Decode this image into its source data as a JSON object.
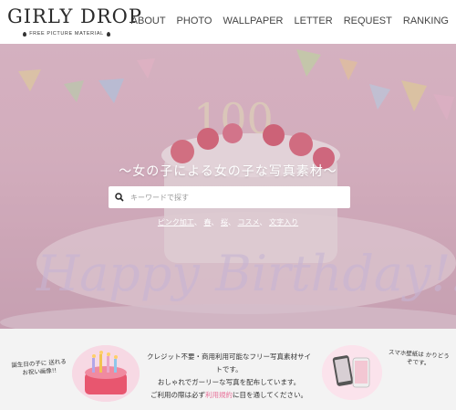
{
  "header": {
    "logo_main": "GIRLY DROP",
    "logo_sub": "FREE PICTURE MATERIAL",
    "nav": [
      "ABOUT",
      "PHOTO",
      "WALLPAPER",
      "LETTER",
      "REQUEST",
      "RANKING"
    ]
  },
  "hero": {
    "tagline": "～女の子による女の子な写真素材～",
    "search_placeholder": "キーワードで探す",
    "quick_links": [
      "ピンク加工",
      "春",
      "桜",
      "コスメ",
      "文字入り"
    ],
    "image_text": {
      "candle_number": "100",
      "lettering": "Happy Birthday!!"
    }
  },
  "intro": {
    "line1": "クレジット不要・商用利用可能なフリー写真素材サイトです。",
    "line2": "おしゃれでガーリーな写真を配布しています。",
    "line3_pre": "ご利用の際は必ず",
    "line3_link": "利用規約",
    "line3_post": "に目を通してください。",
    "note_left": "誕生日の子に 送れる お祝い画像!!",
    "note_right": "スマホ壁紙は かりどうぞです。"
  },
  "colors": {
    "accent_pink": "#e8729a",
    "hero_bg": "#e6bfcd",
    "strip_bg": "#f3f3f3"
  }
}
